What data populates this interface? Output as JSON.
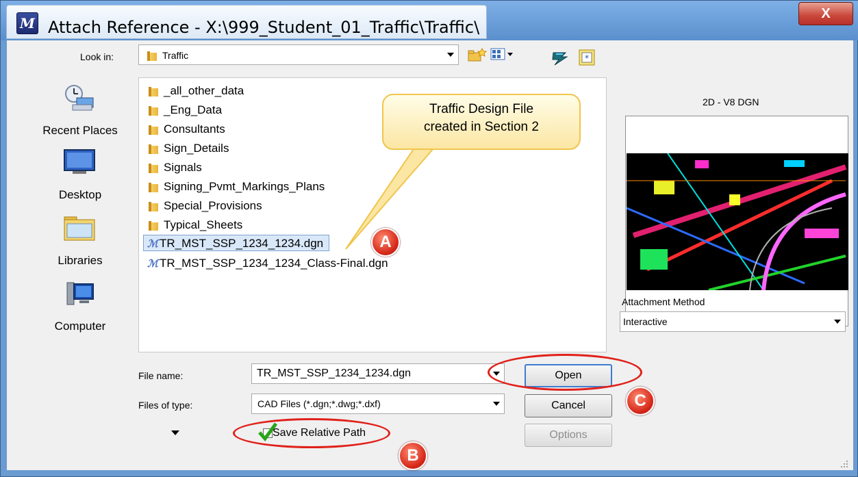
{
  "window": {
    "title": "Attach Reference - X:\\999_Student_01_Traffic\\Traffic\\",
    "close_label": "X"
  },
  "lookin": {
    "label": "Look in:",
    "value": "Traffic"
  },
  "places": [
    {
      "name": "Recent Places",
      "icon": "recent-places-icon"
    },
    {
      "name": "Desktop",
      "icon": "desktop-icon"
    },
    {
      "name": "Libraries",
      "icon": "libraries-icon"
    },
    {
      "name": "Computer",
      "icon": "computer-icon"
    }
  ],
  "files": [
    {
      "name": "_all_other_data",
      "type": "folder"
    },
    {
      "name": "_Eng_Data",
      "type": "folder"
    },
    {
      "name": "Consultants",
      "type": "folder"
    },
    {
      "name": "Sign_Details",
      "type": "folder"
    },
    {
      "name": "Signals",
      "type": "folder"
    },
    {
      "name": "Signing_Pvmt_Markings_Plans",
      "type": "folder"
    },
    {
      "name": "Special_Provisions",
      "type": "folder"
    },
    {
      "name": "Typical_Sheets",
      "type": "folder"
    },
    {
      "name": "TR_MST_SSP_1234_1234.dgn",
      "type": "dgn",
      "selected": true
    },
    {
      "name": "TR_MST_SSP_1234_1234_Class-Final.dgn",
      "type": "dgn"
    }
  ],
  "callout": {
    "line1": "Traffic Design File",
    "line2": "created in Section 2"
  },
  "badges": {
    "a": "A",
    "b": "B",
    "c": "C"
  },
  "preview": {
    "format_label": "2D - V8 DGN"
  },
  "attachment": {
    "label": "Attachment Method",
    "value": "Interactive"
  },
  "filename": {
    "label": "File name:",
    "value": "TR_MST_SSP_1234_1234.dgn"
  },
  "filetype": {
    "label": "Files of type:",
    "value": "CAD Files (*.dgn;*.dwg;*.dxf)"
  },
  "save_relative": {
    "label": "Save Relative Path",
    "checked": true
  },
  "buttons": {
    "open": "Open",
    "cancel": "Cancel",
    "options": "Options"
  },
  "colors": {
    "highlight": "#e0211a",
    "selection": "#d9e8f9",
    "title_bar": "#6a9bd1"
  }
}
